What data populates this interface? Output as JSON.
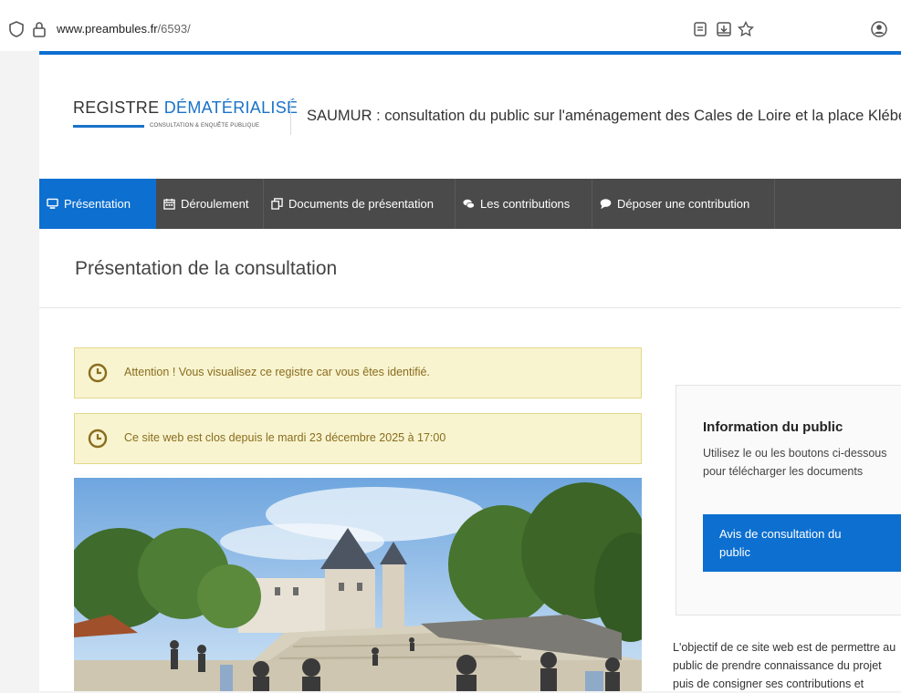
{
  "browser": {
    "url_domain": "www.preambules.fr",
    "url_path": "/6593/"
  },
  "header": {
    "logo_word1": "REGISTRE",
    "logo_word2": "DÉMATÉRIALISÉ",
    "logo_tagline": "CONSULTATION & ENQUÊTE PUBLIQUE",
    "site_title": "SAUMUR : consultation du public sur l'aménagement des Cales de Loire et la place Kléber"
  },
  "nav": {
    "items": [
      {
        "label": "Présentation",
        "icon": "monitor-icon"
      },
      {
        "label": "Déroulement",
        "icon": "calendar-icon"
      },
      {
        "label": "Documents de présentation",
        "icon": "documents-icon"
      },
      {
        "label": "Les contributions",
        "icon": "comments-icon"
      },
      {
        "label": "Déposer une contribution",
        "icon": "comment-icon"
      }
    ]
  },
  "main": {
    "page_title": "Présentation de la consultation",
    "alerts": [
      {
        "text": "Attention ! Vous visualisez ce registre car vous êtes identifié.",
        "icon": "clock-icon"
      },
      {
        "text": "Ce site web est clos depuis le mardi 23 décembre 2025 à 17:00",
        "icon": "clock-icon"
      }
    ]
  },
  "sidebar": {
    "info_title": "Information du public",
    "info_desc": "Utilisez le ou les boutons ci-dessous pour télécharger les documents",
    "button_label": "Avis de consultation du public",
    "paragraph": "L'objectif de ce site web est de permettre au public de prendre connaissance du projet puis de consigner ses contributions et"
  },
  "colors": {
    "accent": "#0d6fd0",
    "nav_bg": "#4a4a4a",
    "alert_bg": "#f8f4d0",
    "alert_text": "#8a6d1e"
  }
}
